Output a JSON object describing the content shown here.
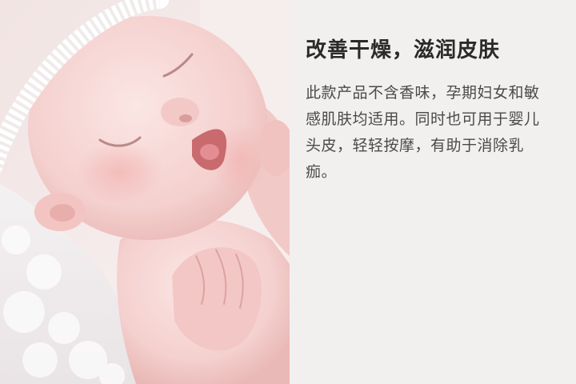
{
  "photo": {
    "icon": "baby-photo",
    "colors": {
      "skin": "#f6d8d6",
      "blanket": "#f7f5f6",
      "headband": "#ffffff"
    }
  },
  "copy": {
    "headline": "改善干燥，滋润皮肤",
    "body": "此款产品不含香味，孕期妇女和敏感肌肤均适用。同时也可用于婴儿头皮，轻轻按摩，有助于消除乳痂。"
  },
  "colors": {
    "panel_bg": "#f2f0ef",
    "headline": "#2a2a2a",
    "body": "#4a4a4a"
  }
}
